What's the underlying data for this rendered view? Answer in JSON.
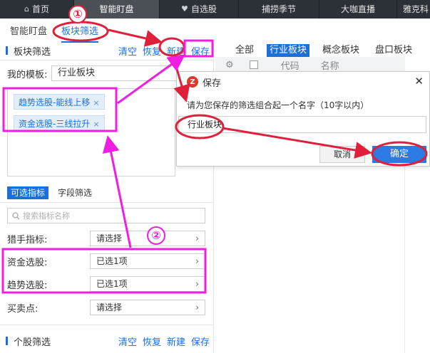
{
  "topnav": {
    "items": [
      {
        "label": "首页",
        "icon": "home-icon"
      },
      {
        "label": "智能盯盘",
        "active": true
      },
      {
        "label": "自选股",
        "icon": "heart-icon"
      },
      {
        "label": "捕捞季节"
      },
      {
        "label": "大咖直播"
      },
      {
        "label": "雅克科"
      }
    ]
  },
  "subtabs": [
    {
      "label": "智能盯盘"
    },
    {
      "label": "板块筛选",
      "active": true
    }
  ],
  "panel_top": {
    "title": "板块筛选",
    "actions": [
      "清空",
      "恢复",
      "新建",
      "保存"
    ]
  },
  "template": {
    "label": "我的模板:",
    "value": "行业板块",
    "tags": [
      {
        "text": "趋势选股-能线上移",
        "close": "×"
      },
      {
        "text": "资金选股-三线拉升",
        "close": "×"
      }
    ]
  },
  "filter_tabs": [
    {
      "label": "可选指标",
      "active": true
    },
    {
      "label": "字段筛选"
    }
  ],
  "search": {
    "placeholder": "搜索指标名称"
  },
  "filters": [
    {
      "label": "猎手指标:",
      "value": "请选择"
    },
    {
      "label": "资金选股:",
      "value": "已选1项"
    },
    {
      "label": "趋势选股:",
      "value": "已选1项"
    },
    {
      "label": "买卖点:",
      "value": "请选择"
    }
  ],
  "panel_bottom": {
    "title": "个股筛选",
    "actions": [
      "清空",
      "恢复",
      "新建",
      "保存"
    ]
  },
  "right": {
    "tabs": [
      {
        "label": "全部"
      },
      {
        "label": "行业板块",
        "active": true
      },
      {
        "label": "概念板块"
      },
      {
        "label": "盘口板块"
      }
    ],
    "columns": [
      "代码",
      "名称"
    ]
  },
  "dialog": {
    "logo_letter": "Z",
    "title": "保存",
    "close": "✕",
    "prompt": "请为您保存的筛选组合起一个名字（10字以内）",
    "input_value": "行业板块",
    "cancel_label": "取消",
    "ok_label": "确定"
  },
  "annotations": {
    "badge_1": "①",
    "badge_2": "②",
    "red": "#e0203a",
    "magenta": "#f01ee0"
  },
  "colors": {
    "accent": "#1b6fd6",
    "nav_bg": "#2b3136",
    "ok_button": "#2c7be5"
  }
}
